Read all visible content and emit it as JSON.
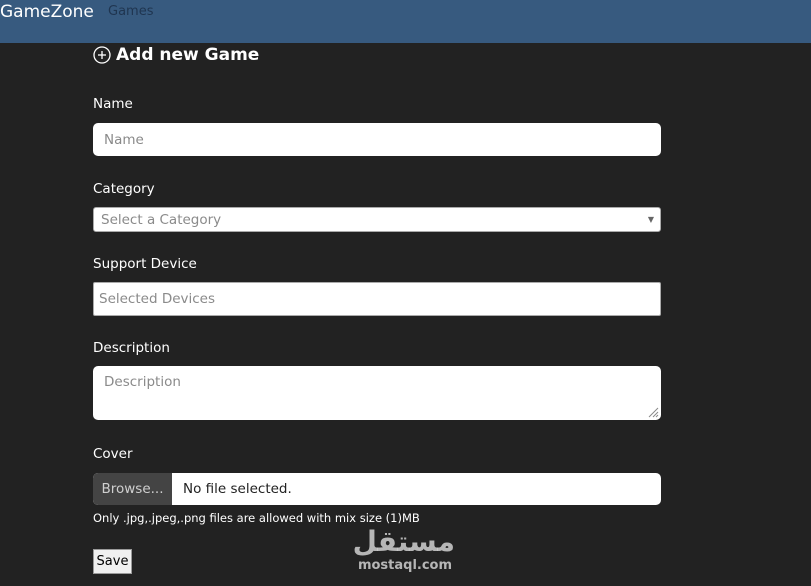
{
  "navbar": {
    "brand": "GameZone",
    "links": [
      "Games"
    ]
  },
  "form": {
    "heading": "Add new Game",
    "heading_icon": "plus-circle-icon",
    "name": {
      "label": "Name",
      "placeholder": "Name",
      "value": ""
    },
    "category": {
      "label": "Category",
      "placeholder": "Select a Category",
      "selected": ""
    },
    "devices": {
      "label": "Support Device",
      "placeholder": "Selected Devices"
    },
    "description": {
      "label": "Description",
      "placeholder": "Description",
      "value": ""
    },
    "cover": {
      "label": "Cover",
      "browse_label": "Browse...",
      "file_status": "No file selected.",
      "hint": "Only .jpg,.jpeg,.png files are allowed with mix size (1)MB"
    },
    "save_label": "Save"
  },
  "watermark": {
    "arabic": "مستقل",
    "domain": "mostaql.com"
  },
  "colors": {
    "background": "#222222",
    "navbar": "#375a7f",
    "input_bg": "#ffffff",
    "browse_bg": "#444444"
  }
}
